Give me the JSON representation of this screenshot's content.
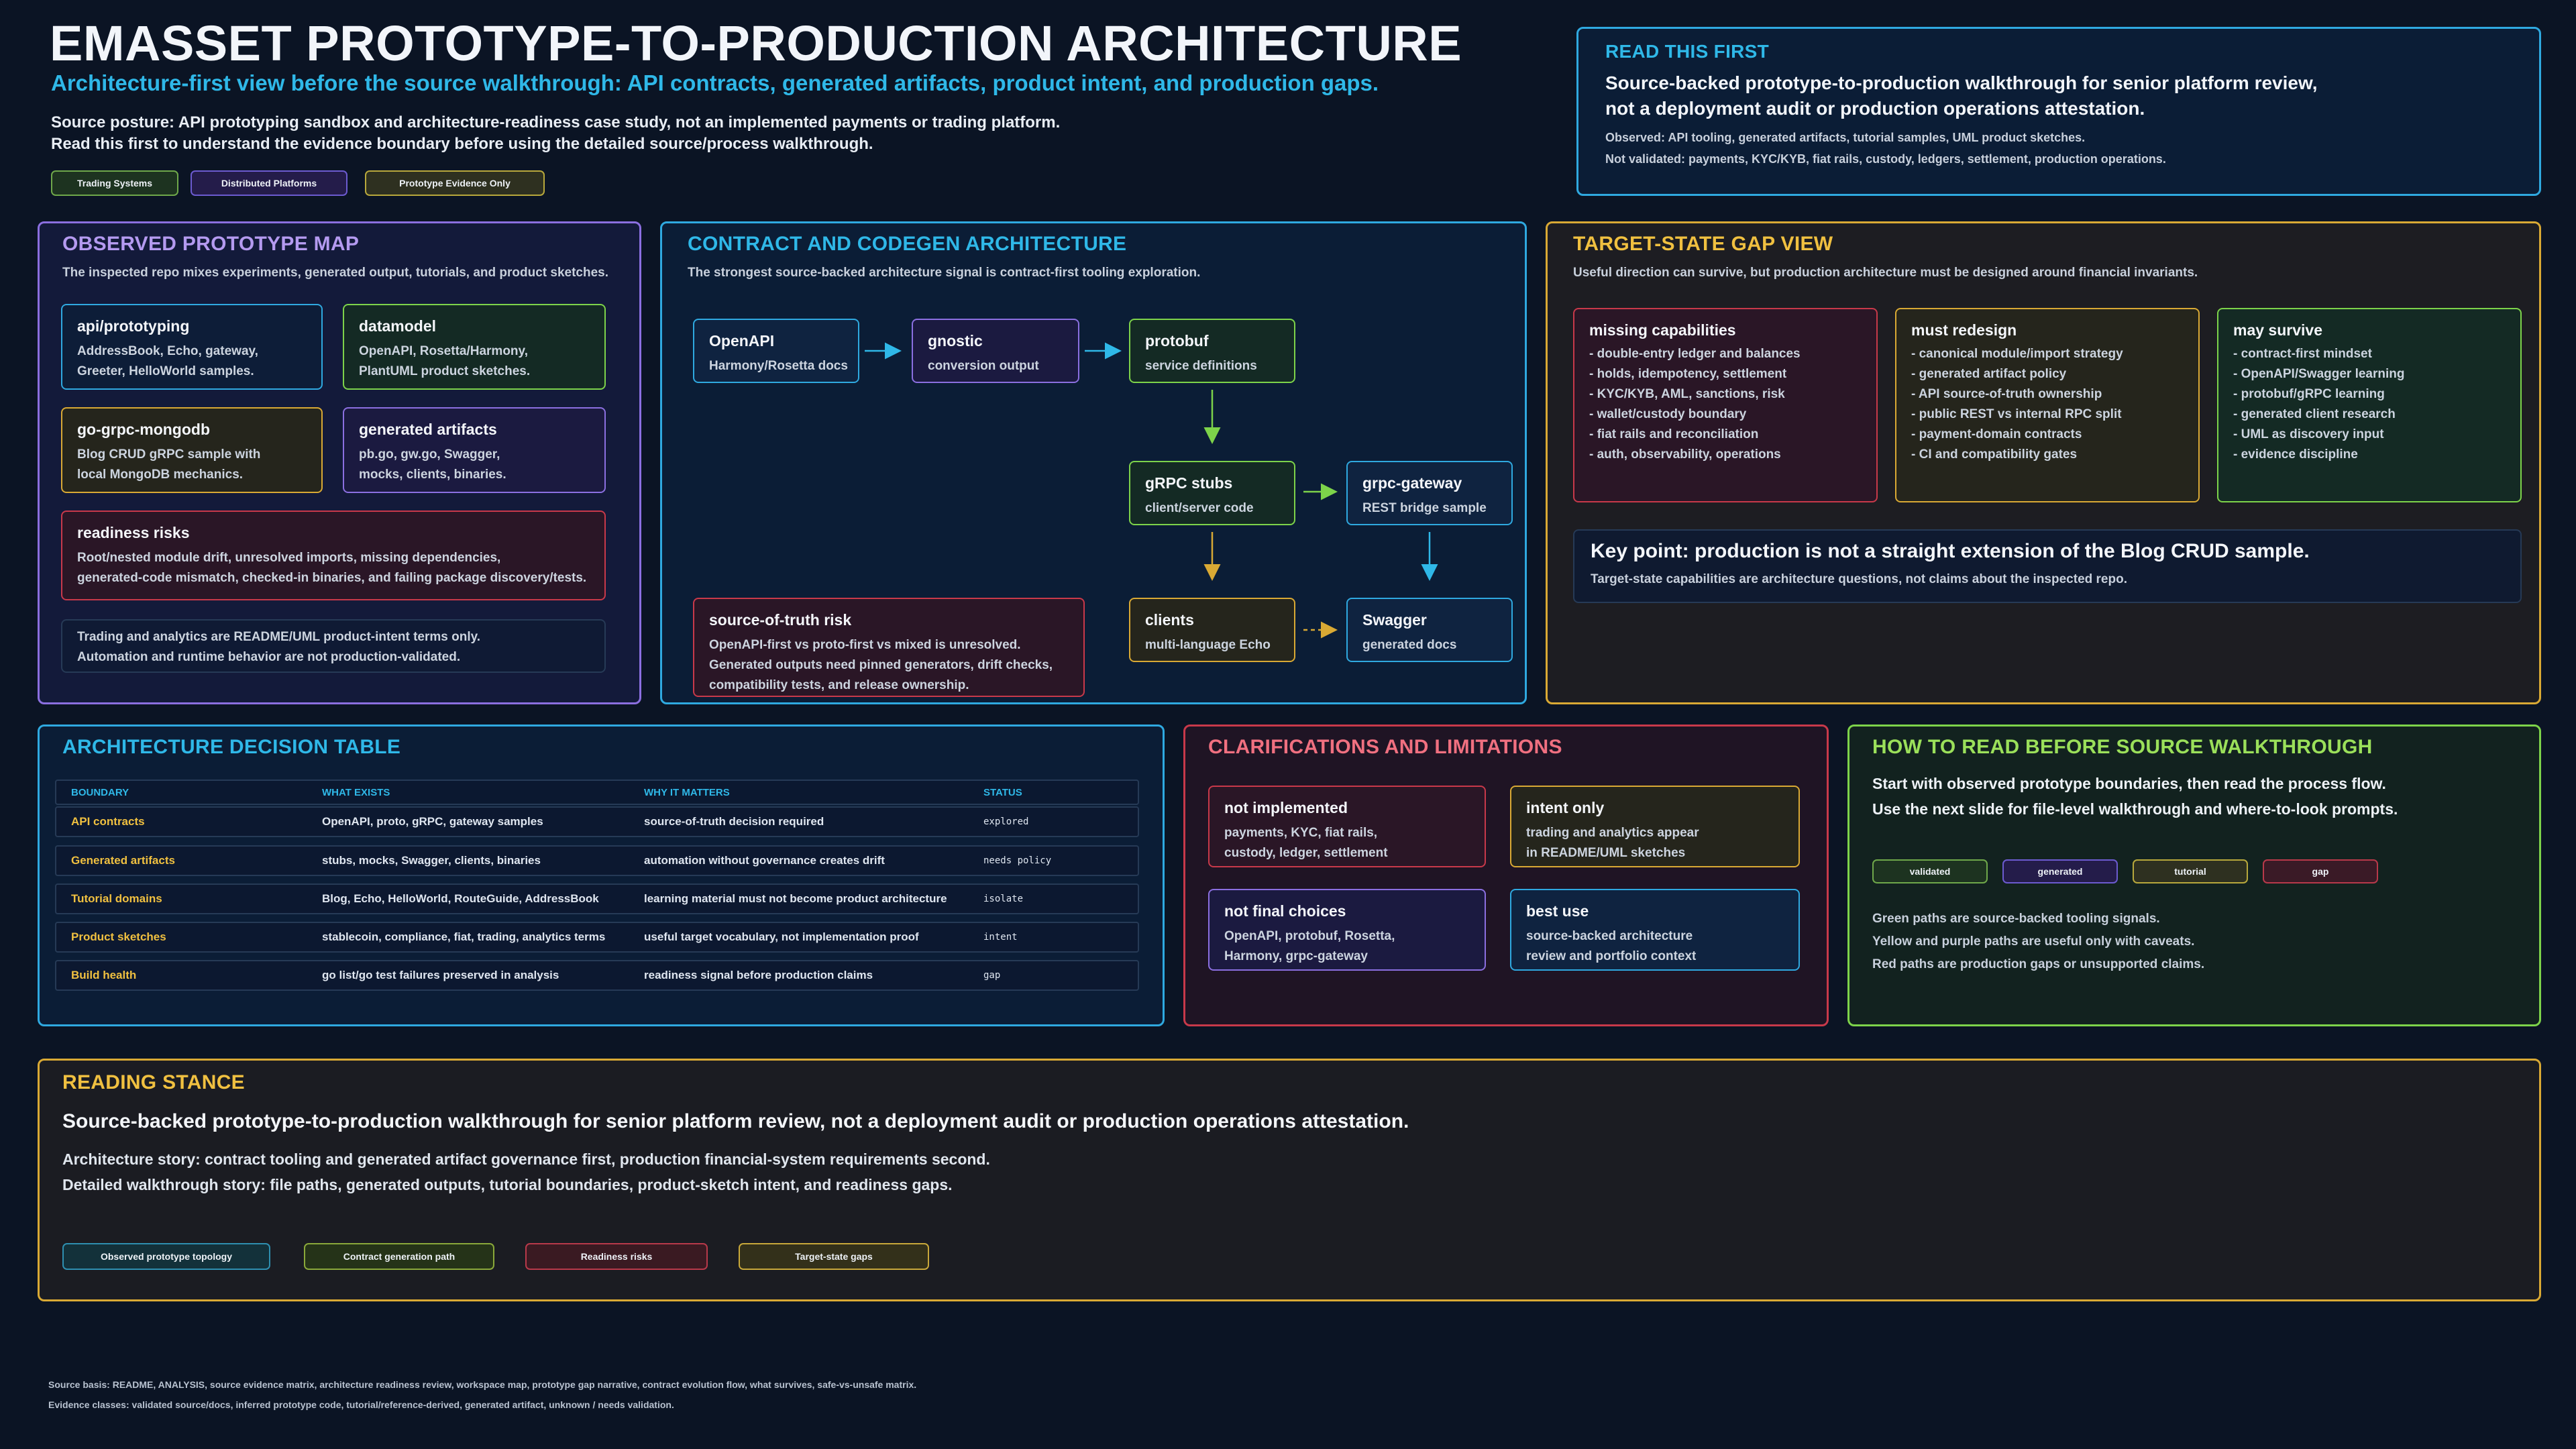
{
  "header": {
    "title": "EMASSET PROTOTYPE-TO-PRODUCTION ARCHITECTURE",
    "subtitle": "Architecture-first view before the source walkthrough: API contracts, generated artifacts, product intent, and production gaps.",
    "posture_line1": "Source posture: API prototyping sandbox and architecture-readiness case study, not an implemented payments or trading platform.",
    "posture_line2": "Read this first to understand the evidence boundary before using the detailed source/process walkthrough.",
    "tags": [
      "Trading Systems",
      "Distributed Platforms",
      "Prototype Evidence Only"
    ]
  },
  "read_first": {
    "title": "READ THIS FIRST",
    "headline": "Source-backed prototype-to-production walkthrough for senior platform review,\nnot a deployment audit or production operations attestation.",
    "observed": "Observed: API tooling, generated artifacts, tutorial samples, UML product sketches.",
    "not_validated": "Not validated: payments, KYC/KYB, fiat rails, custody, ledgers, settlement, production operations."
  },
  "prototype_map": {
    "title": "OBSERVED PROTOTYPE MAP",
    "sub": "The inspected repo mixes experiments, generated output, tutorials, and product sketches.",
    "boxes": [
      {
        "title": "api/prototyping",
        "body": "AddressBook, Echo, gateway,\nGreeter, HelloWorld samples."
      },
      {
        "title": "datamodel",
        "body": "OpenAPI, Rosetta/Harmony,\nPlantUML product sketches."
      },
      {
        "title": "go-grpc-mongodb",
        "body": "Blog CRUD gRPC sample with\nlocal MongoDB mechanics."
      },
      {
        "title": "generated artifacts",
        "body": "pb.go, gw.go, Swagger,\nmocks, clients, binaries."
      },
      {
        "title": "readiness risks",
        "body": "Root/nested module drift, unresolved imports, missing dependencies,\ngenerated-code mismatch, checked-in binaries, and failing package discovery/tests."
      }
    ],
    "note": "Trading and analytics are README/UML product-intent terms only.\nAutomation and runtime behavior are not production-validated."
  },
  "contract": {
    "title": "CONTRACT AND CODEGEN ARCHITECTURE",
    "sub": "The strongest source-backed architecture signal is contract-first tooling exploration.",
    "nodes": [
      {
        "title": "OpenAPI",
        "body": "Harmony/Rosetta docs"
      },
      {
        "title": "gnostic",
        "body": "conversion output"
      },
      {
        "title": "protobuf",
        "body": "service definitions"
      },
      {
        "title": "gRPC stubs",
        "body": "client/server code"
      },
      {
        "title": "grpc-gateway",
        "body": "REST bridge sample"
      },
      {
        "title": "clients",
        "body": "multi-language Echo"
      },
      {
        "title": "Swagger",
        "body": "generated docs"
      }
    ],
    "risk_title": "source-of-truth risk",
    "risk_body": "OpenAPI-first vs proto-first vs mixed is unresolved.\nGenerated outputs need pinned generators, drift checks,\ncompatibility tests, and release ownership."
  },
  "gap_view": {
    "title": "TARGET-STATE GAP VIEW",
    "sub": "Useful direction can survive, but production architecture must be designed around financial invariants.",
    "columns": [
      {
        "title": "missing capabilities",
        "items": "- double-entry ledger and balances\n- holds, idempotency, settlement\n- KYC/KYB, AML, sanctions, risk\n- wallet/custody boundary\n- fiat rails and reconciliation\n- auth, observability, operations"
      },
      {
        "title": "must redesign",
        "items": "- canonical module/import strategy\n- generated artifact policy\n- API source-of-truth ownership\n- public REST vs internal RPC split\n- payment-domain contracts\n- CI and compatibility gates"
      },
      {
        "title": "may survive",
        "items": "- contract-first mindset\n- OpenAPI/Swagger learning\n- protobuf/gRPC learning\n- generated client research\n- UML as discovery input\n- evidence discipline"
      }
    ],
    "key_point": "Key point: production is not a straight extension of the Blog CRUD sample.",
    "key_sub": "Target-state capabilities are architecture questions, not claims about the inspected repo."
  },
  "decision_table": {
    "title": "ARCHITECTURE DECISION TABLE",
    "headers": [
      "BOUNDARY",
      "WHAT EXISTS",
      "WHY IT MATTERS",
      "STATUS"
    ],
    "rows": [
      [
        "API contracts",
        "OpenAPI, proto, gRPC, gateway samples",
        "source-of-truth decision required",
        "explored"
      ],
      [
        "Generated artifacts",
        "stubs, mocks, Swagger, clients, binaries",
        "automation without governance creates drift",
        "needs policy"
      ],
      [
        "Tutorial domains",
        "Blog, Echo, HelloWorld, RouteGuide, AddressBook",
        "learning material must not become product architecture",
        "isolate"
      ],
      [
        "Product sketches",
        "stablecoin, compliance, fiat, trading, analytics terms",
        "useful target vocabulary, not implementation proof",
        "intent"
      ],
      [
        "Build health",
        "go list/go test failures preserved in analysis",
        "readiness signal before production claims",
        "gap"
      ]
    ]
  },
  "clarifications": {
    "title": "CLARIFICATIONS AND LIMITATIONS",
    "boxes": [
      {
        "title": "not implemented",
        "body": "payments, KYC, fiat rails,\ncustody, ledger, settlement"
      },
      {
        "title": "intent only",
        "body": "trading and analytics appear\nin README/UML sketches"
      },
      {
        "title": "not final choices",
        "body": "OpenAPI, protobuf, Rosetta,\nHarmony, grpc-gateway"
      },
      {
        "title": "best use",
        "body": "source-backed architecture\nreview and portfolio context"
      }
    ]
  },
  "how_to_read": {
    "title": "HOW TO READ BEFORE SOURCE WALKTHROUGH",
    "line1": "Start with observed prototype boundaries, then read the process flow.",
    "line2": "Use the next slide for file-level walkthrough and where-to-look prompts.",
    "legend": [
      "validated",
      "generated",
      "tutorial",
      "gap"
    ],
    "notes": "Green paths are source-backed tooling signals.\nYellow and purple paths are useful only with caveats.\nRed paths are production gaps or unsupported claims."
  },
  "stance": {
    "title": "READING STANCE",
    "headline": "Source-backed prototype-to-production walkthrough for senior platform review, not a deployment audit or production operations attestation.",
    "line1": "Architecture story: contract tooling and generated artifact governance first, production financial-system requirements second.",
    "line2": "Detailed walkthrough story: file paths, generated outputs, tutorial boundaries, product-sketch intent, and readiness gaps.",
    "tags": [
      "Observed prototype topology",
      "Contract generation path",
      "Readiness risks",
      "Target-state gaps"
    ]
  },
  "footer": {
    "line1": "Source basis: README, ANALYSIS, source evidence matrix, architecture readiness review, workspace map, prototype gap narrative, contract evolution flow, what survives, safe-vs-unsafe matrix.",
    "line2": "Evidence classes: validated source/docs, inferred prototype code, tutorial/reference-derived, generated artifact, unknown / needs validation."
  },
  "colors": {
    "purple": "#8b6fe0",
    "blue": "#2fa9e0",
    "gold": "#d9a934",
    "green": "#7dd34a",
    "red": "#c8394a",
    "teal": "#2e8fb0"
  }
}
